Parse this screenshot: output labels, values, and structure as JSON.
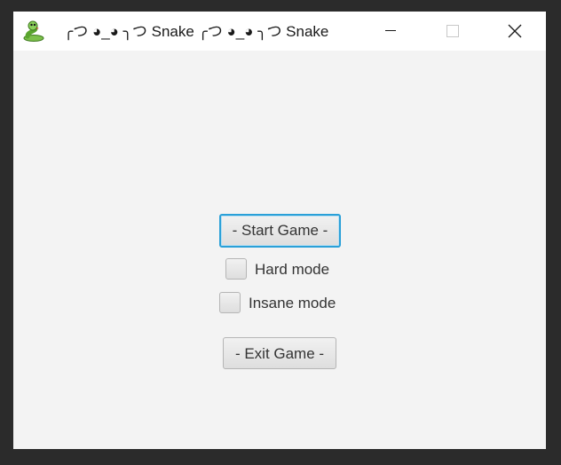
{
  "window": {
    "title": "╭つ ◕_◕ ╮つ Snake ╭つ ◕_◕ ╮つ Snake",
    "app_icon": "snake-icon",
    "controls": {
      "minimize_icon": "minimize-icon",
      "maximize_icon": "maximize-icon",
      "close_icon": "close-icon"
    }
  },
  "menu": {
    "start_label": "- Start Game -",
    "hard_label": "Hard mode",
    "hard_checked": false,
    "insane_label": "Insane mode",
    "insane_checked": false,
    "exit_label": "- Exit Game -"
  },
  "colors": {
    "focus_border": "#2aa0d8",
    "window_background": "#f3f3f3",
    "titlebar_background": "#ffffff"
  }
}
